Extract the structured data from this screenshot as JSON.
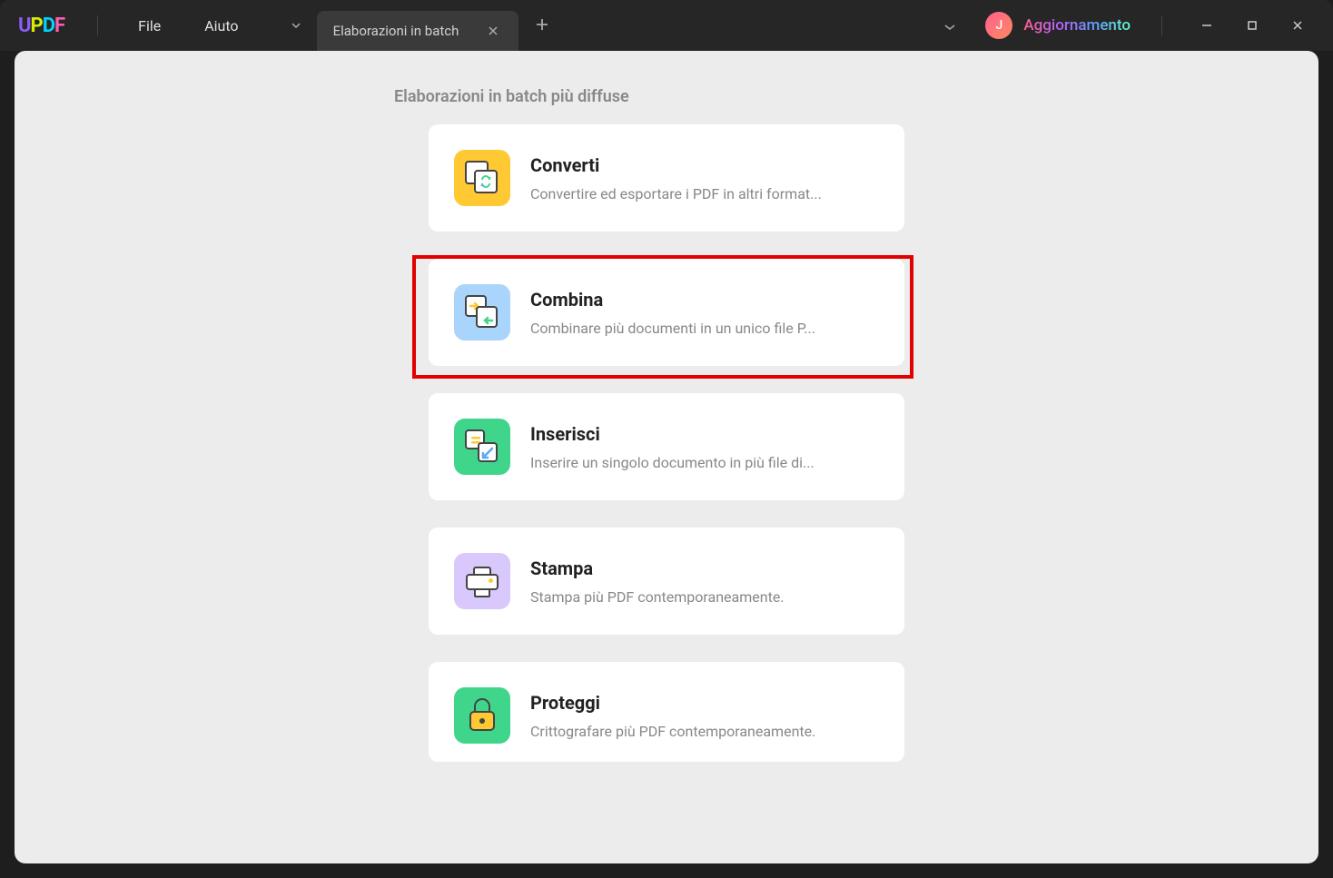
{
  "menu": {
    "file": "File",
    "help": "Aiuto"
  },
  "tab": {
    "title": "Elaborazioni in batch"
  },
  "titlebar": {
    "avatar_initial": "J",
    "upgrade": "Aggiornamento"
  },
  "section": {
    "title": "Elaborazioni in batch più diffuse"
  },
  "cards": [
    {
      "id": "convert",
      "title": "Converti",
      "desc": "Convertire ed esportare i PDF in altri format...",
      "icon": "convert-icon",
      "highlighted": false
    },
    {
      "id": "combine",
      "title": "Combina",
      "desc": "Combinare più documenti in un unico file P...",
      "icon": "combine-icon",
      "highlighted": true
    },
    {
      "id": "insert",
      "title": "Inserisci",
      "desc": "Inserire un singolo documento in più file di...",
      "icon": "insert-icon",
      "highlighted": false
    },
    {
      "id": "print",
      "title": "Stampa",
      "desc": "Stampa più PDF contemporaneamente.",
      "icon": "print-icon",
      "highlighted": false
    },
    {
      "id": "protect",
      "title": "Proteggi",
      "desc": "Crittografare più PDF contemporaneamente.",
      "icon": "protect-icon",
      "highlighted": false
    }
  ]
}
